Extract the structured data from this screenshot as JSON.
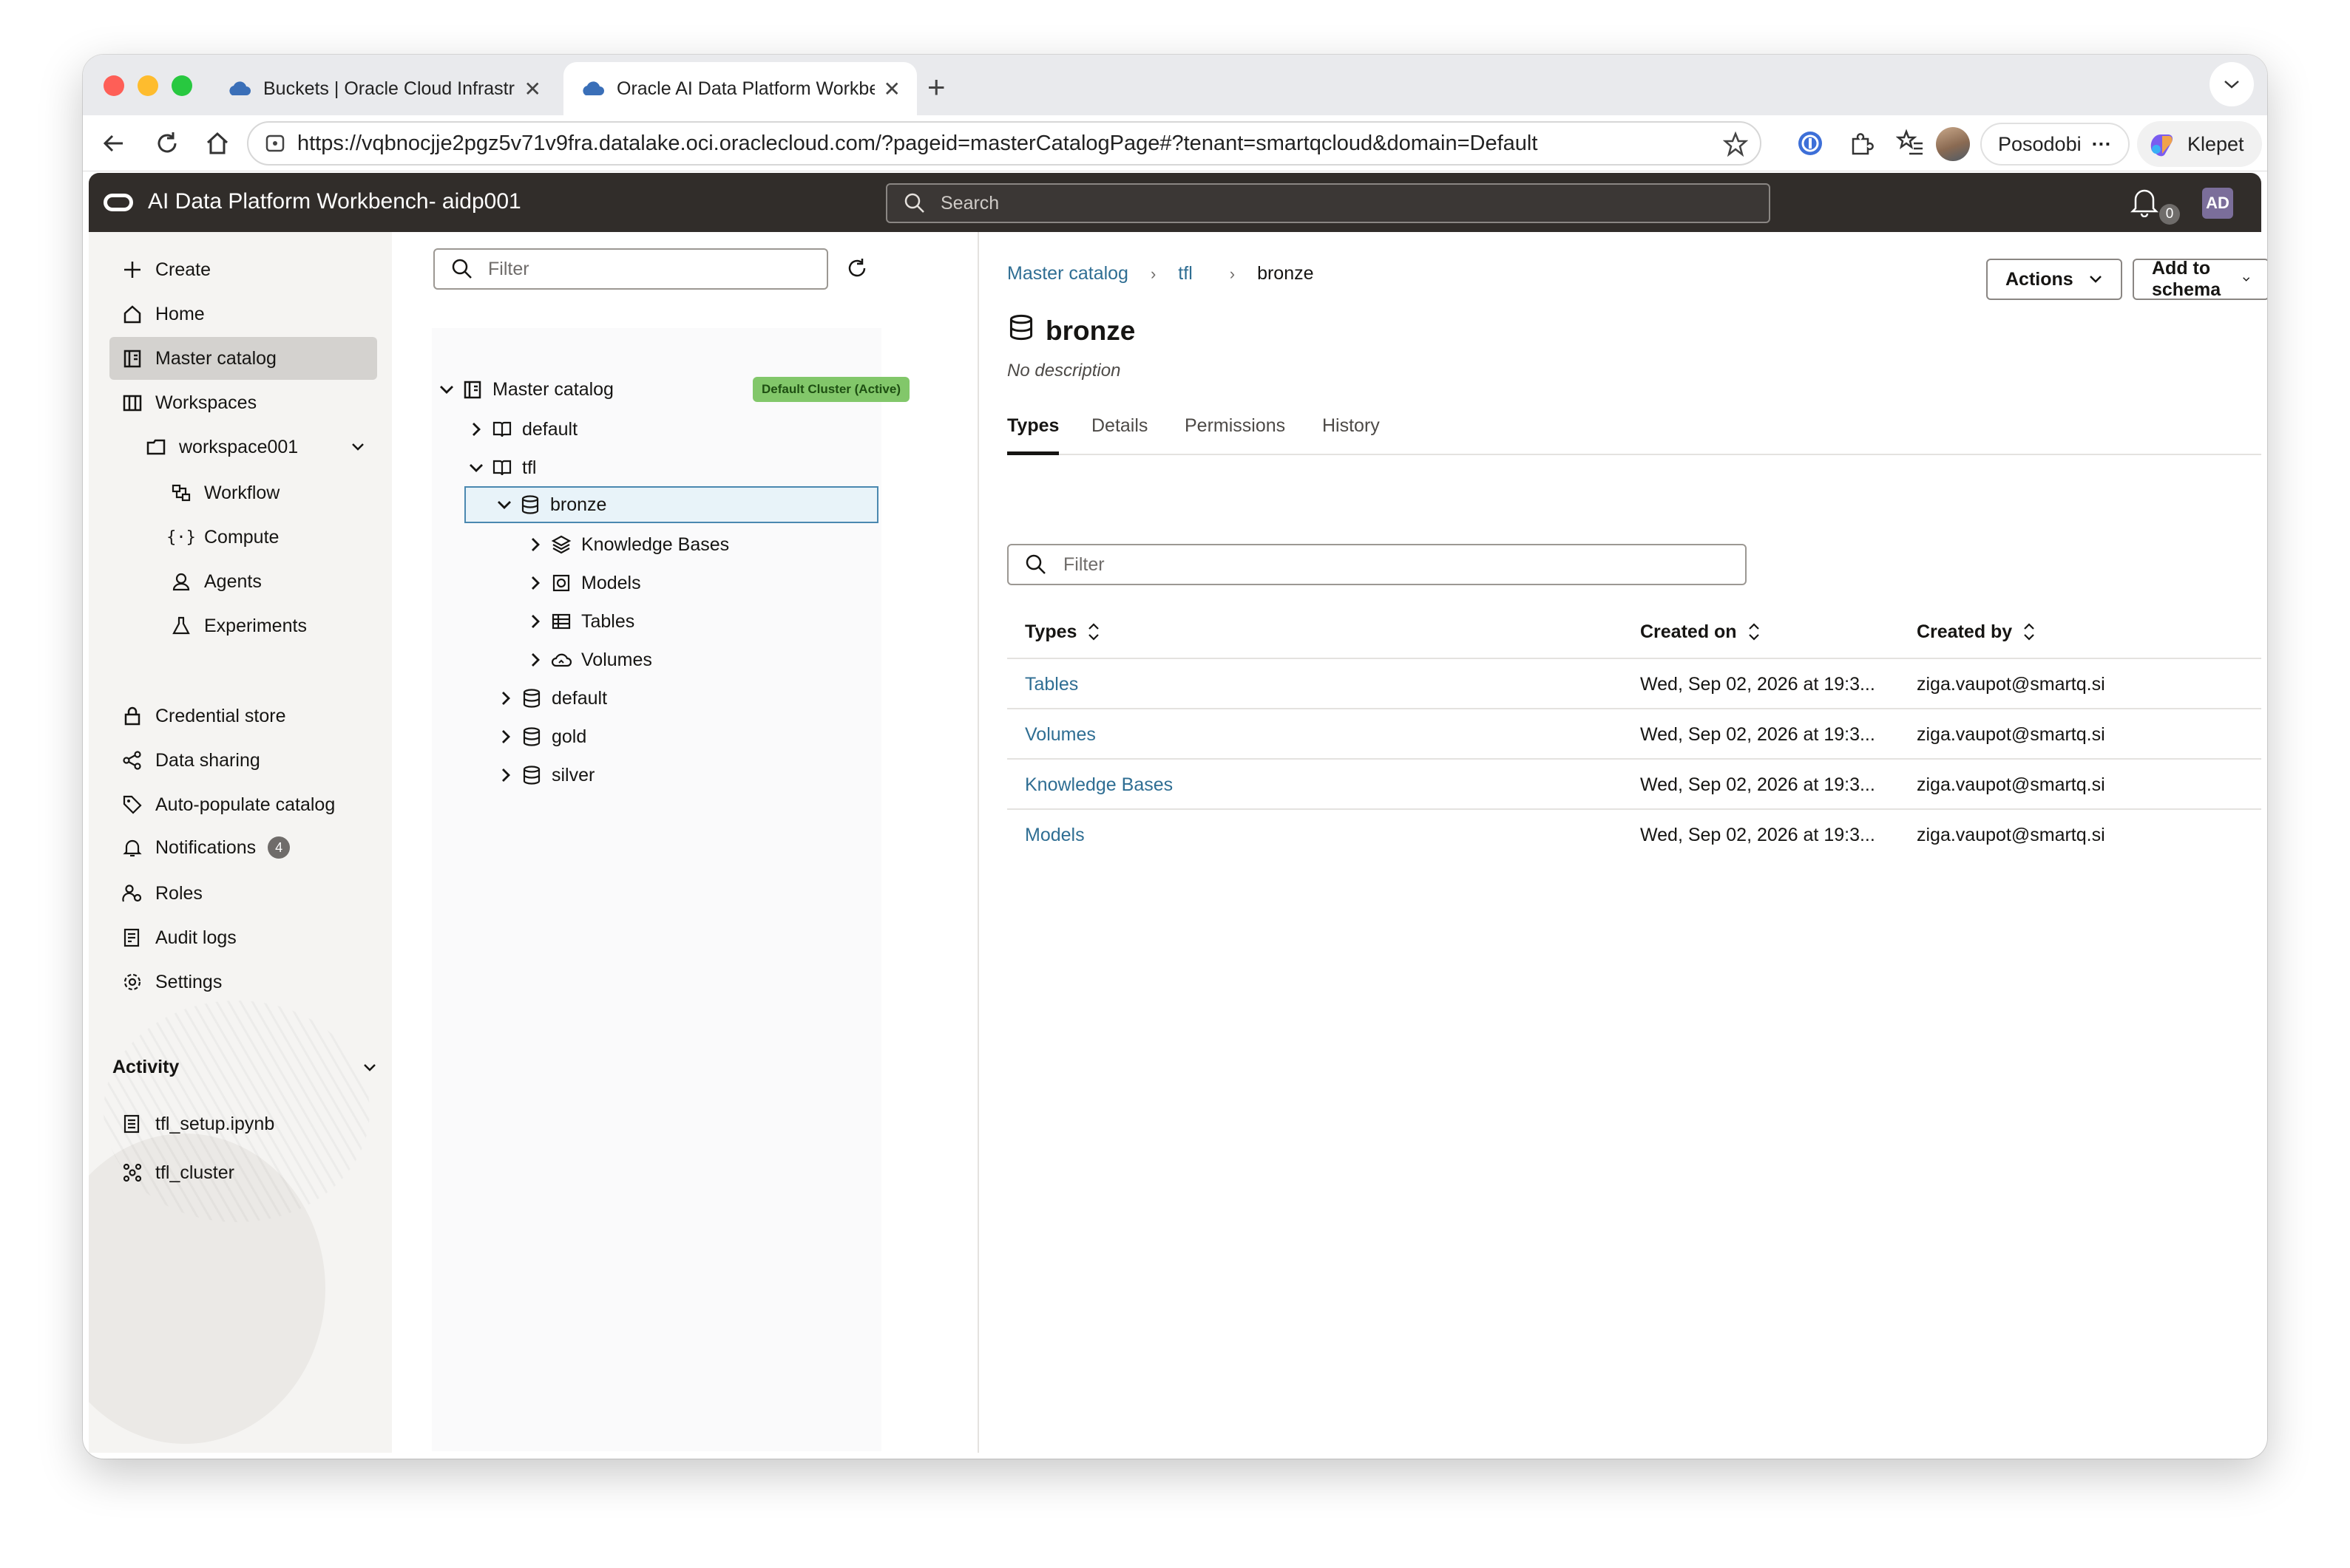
{
  "browser": {
    "tabs": [
      {
        "label": "Buckets | Oracle Cloud Infrastructure"
      },
      {
        "label": "Oracle AI Data Platform Workbench"
      }
    ],
    "url": "https://vqbnocjje2pgz5v71v9fra.datalake.oci.oraclecloud.com/?pageid=masterCatalogPage#?tenant=smartqcloud&domain=Default",
    "profile_label": "Posodobi",
    "copilot_label": "Klepet"
  },
  "header": {
    "title": "AI Data Platform Workbench- aidp001",
    "search_placeholder": "Search",
    "notification_count": "0",
    "user_initials": "AD"
  },
  "sidebar": {
    "items": [
      {
        "label": "Create"
      },
      {
        "label": "Home"
      },
      {
        "label": "Master catalog"
      },
      {
        "label": "Workspaces"
      },
      {
        "label": "workspace001"
      },
      {
        "label": "Workflow"
      },
      {
        "label": "Compute"
      },
      {
        "label": "Agents"
      },
      {
        "label": "Experiments"
      },
      {
        "label": "Credential store"
      },
      {
        "label": "Data sharing"
      },
      {
        "label": "Auto-populate catalog"
      },
      {
        "label": "Notifications",
        "badge": "4"
      },
      {
        "label": "Roles"
      },
      {
        "label": "Audit logs"
      },
      {
        "label": "Settings"
      }
    ],
    "activity_title": "Activity",
    "activity_items": [
      {
        "label": "tfl_setup.ipynb"
      },
      {
        "label": "tfl_cluster"
      }
    ]
  },
  "tree": {
    "filter_placeholder": "Filter",
    "root": "Master catalog",
    "cluster_badge": "Default Cluster (Active)",
    "nodes": [
      {
        "label": "default"
      },
      {
        "label": "tfl"
      },
      {
        "label": "bronze"
      },
      {
        "label": "Knowledge Bases"
      },
      {
        "label": "Models"
      },
      {
        "label": "Tables"
      },
      {
        "label": "Volumes"
      },
      {
        "label": "default"
      },
      {
        "label": "gold"
      },
      {
        "label": "silver"
      }
    ]
  },
  "main": {
    "breadcrumb": [
      "Master catalog",
      "tfl",
      "bronze"
    ],
    "actions_label": "Actions",
    "add_to_schema_label": "Add to schema",
    "title": "bronze",
    "description": "No description",
    "tabs": [
      {
        "label": "Types"
      },
      {
        "label": "Details"
      },
      {
        "label": "Permissions"
      },
      {
        "label": "History"
      }
    ],
    "filter_placeholder": "Filter",
    "table": {
      "columns": [
        "Types",
        "Created on",
        "Created by"
      ],
      "rows": [
        {
          "type": "Tables",
          "created_on": "Wed, Sep 02, 2026 at 19:3...",
          "created_by": "ziga.vaupot@smartq.si"
        },
        {
          "type": "Volumes",
          "created_on": "Wed, Sep 02, 2026 at 19:3...",
          "created_by": "ziga.vaupot@smartq.si"
        },
        {
          "type": "Knowledge Bases",
          "created_on": "Wed, Sep 02, 2026 at 19:3...",
          "created_by": "ziga.vaupot@smartq.si"
        },
        {
          "type": "Models",
          "created_on": "Wed, Sep 02, 2026 at 19:3...",
          "created_by": "ziga.vaupot@smartq.si"
        }
      ]
    }
  },
  "colors": {
    "header_bg": "#312d2a",
    "link": "#2f6e93",
    "cluster_badge": "#82c76a",
    "selected_node_border": "#4a88b0"
  }
}
